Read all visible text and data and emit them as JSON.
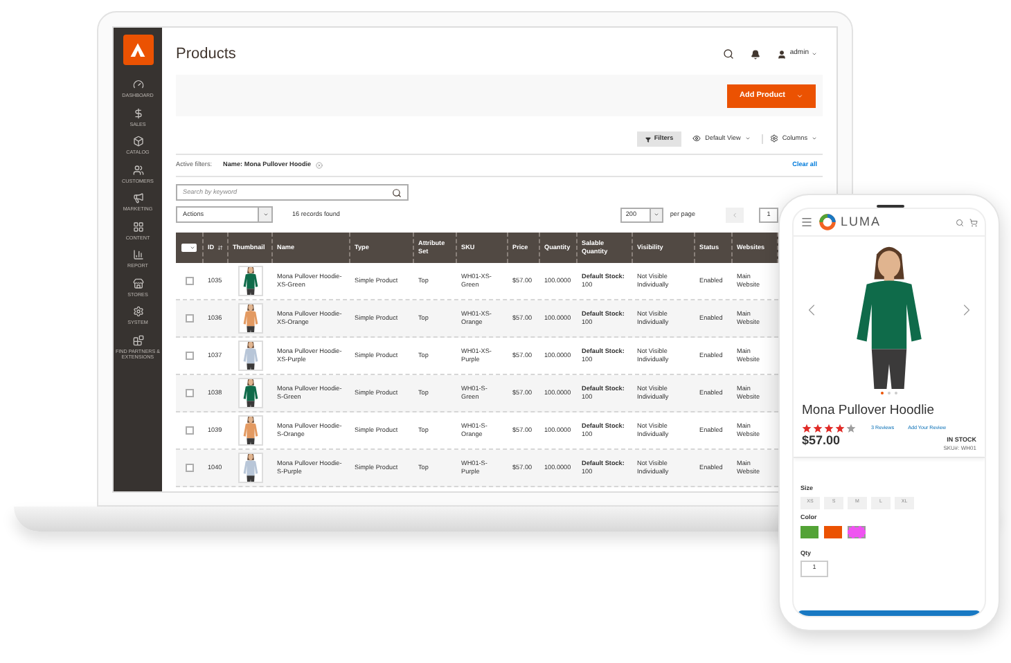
{
  "laptop": {
    "sidebar": {
      "items": [
        {
          "label": "DASHBOARD"
        },
        {
          "label": "SALES"
        },
        {
          "label": "CATALOG"
        },
        {
          "label": "CUSTOMERS"
        },
        {
          "label": "MARKETING"
        },
        {
          "label": "CONTENT"
        },
        {
          "label": "REPORT"
        },
        {
          "label": "STORES"
        },
        {
          "label": "SYSTEM"
        },
        {
          "label": "FIND PARTNERS & EXTENSIONS"
        }
      ]
    },
    "header": {
      "title": "Products",
      "user": "admin"
    },
    "add_button": "Add Product",
    "toolbar": {
      "filters": "Filters",
      "view": "Default View",
      "columns": "Columns"
    },
    "active_filters": {
      "label": "Active filters:",
      "filter": "Name: Mona Pullover Hoodie",
      "clear": "Clear all"
    },
    "search": {
      "placeholder": "Search by keyword"
    },
    "actions": "Actions",
    "records": "16 records found",
    "pagination": {
      "per_page_value": "200",
      "per_page_label": "per page",
      "page": "1"
    },
    "table": {
      "select_all": {
        "checked": false
      },
      "columns": [
        "ID",
        "Thumbnail",
        "Name",
        "Type",
        "Attribute Set",
        "SKU",
        "Price",
        "Quantity",
        "Salable Quantity",
        "Visibility",
        "Status",
        "Websites"
      ],
      "rows": [
        {
          "checked": false,
          "id": "1035",
          "name": "Mona Pullover Hoodie-XS-Green",
          "type": "Simple Product",
          "attribute_set": "Top",
          "sku": "WH01-XS-Green",
          "price": "$57.00",
          "quantity": "100.0000",
          "salable_quantity": "**Default Stock:** 100",
          "visibility": "Not Visible Individually",
          "status": "Enabled",
          "websites": "Main Website"
        },
        {
          "checked": false,
          "id": "1036",
          "name": "Mona Pullover Hoodie-XS-Orange",
          "type": "Simple Product",
          "attribute_set": "Top",
          "sku": "WH01-XS-Orange",
          "price": "$57.00",
          "quantity": "100.0000",
          "salable_quantity": "**Default Stock:** 100",
          "visibility": "Not Visible Individually",
          "status": "Enabled",
          "websites": "Main Website"
        },
        {
          "checked": false,
          "id": "1037",
          "name": "Mona Pullover Hoodie-XS-Purple",
          "type": "Simple Product",
          "attribute_set": "Top",
          "sku": "WH01-XS-Purple",
          "price": "$57.00",
          "quantity": "100.0000",
          "salable_quantity": "**Default Stock:** 100",
          "visibility": "Not Visible Individually",
          "status": "Enabled",
          "websites": "Main Website"
        },
        {
          "checked": false,
          "id": "1038",
          "name": "Mona Pullover Hoodie-S-Green",
          "type": "Simple Product",
          "attribute_set": "Top",
          "sku": "WH01-S-Green",
          "price": "$57.00",
          "quantity": "100.0000",
          "salable_quantity": "**Default Stock:** 100",
          "visibility": "Not Visible Individually",
          "status": "Enabled",
          "websites": "Main Website"
        },
        {
          "checked": false,
          "id": "1039",
          "name": "Mona Pullover Hoodie-S-Orange",
          "type": "Simple Product",
          "attribute_set": "Top",
          "sku": "WH01-S-Orange",
          "price": "$57.00",
          "quantity": "100.0000",
          "salable_quantity": "**Default Stock:** 100",
          "visibility": "Not Visible Individually",
          "status": "Enabled",
          "websites": "Main Website"
        },
        {
          "checked": false,
          "id": "1040",
          "name": "Mona Pullover Hoodie-S-Purple",
          "type": "Simple Product",
          "attribute_set": "Top",
          "sku": "WH01-S-Purple",
          "price": "$57.00",
          "quantity": "100.0000",
          "salable_quantity": "**Default Stock:** 100",
          "visibility": "Not Visible Individually",
          "status": "Enabled",
          "websites": "Main Website"
        }
      ]
    }
  },
  "phone": {
    "logo": "LUMA",
    "carousel_dots": [
      {
        "selected": true
      },
      {
        "selected": false
      },
      {
        "selected": false
      }
    ],
    "product_name": "Mona Pullover Hoodlie",
    "stars": 4,
    "reviews": "3 Reviews",
    "add_review": "Add Your Review",
    "price": "$57.00",
    "stock": "IN STOCK",
    "sku": "SKU#: WH01",
    "size_label": "Size",
    "sizes": [
      {
        "label": "XS",
        "selected": false
      },
      {
        "label": "S",
        "selected": false
      },
      {
        "label": "M",
        "selected": false
      },
      {
        "label": "L",
        "selected": false
      },
      {
        "label": "XL",
        "selected": false
      }
    ],
    "color_label": "Color",
    "colors": [
      {
        "color": "#53a336",
        "selected": false
      },
      {
        "color": "#eb5202",
        "selected": false
      },
      {
        "color": "#ef53f1",
        "selected": true
      }
    ],
    "qty_label": "Qty",
    "qty": "1"
  }
}
